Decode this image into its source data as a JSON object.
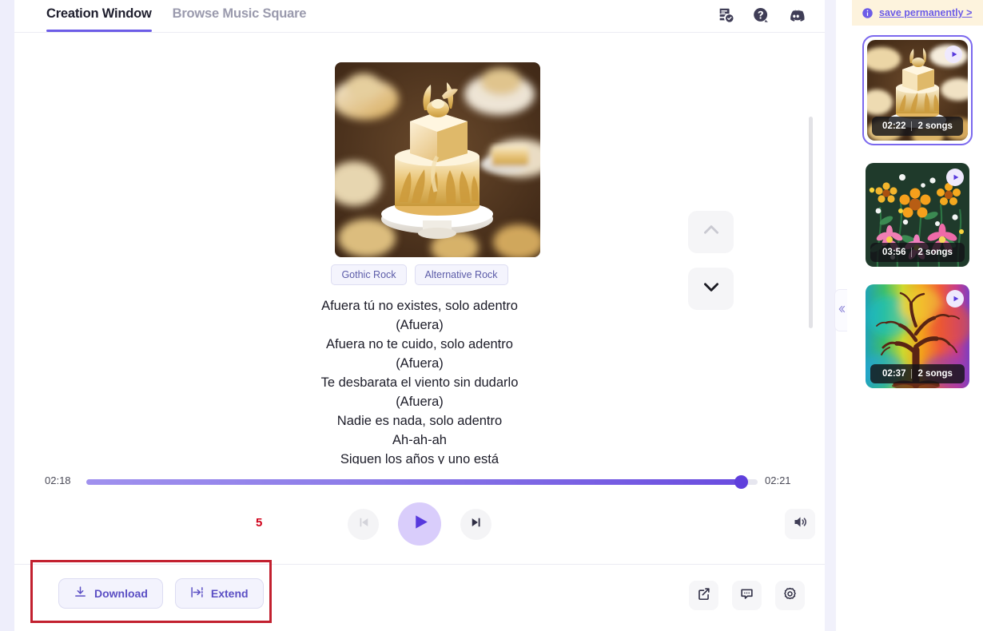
{
  "header": {
    "tabs": [
      {
        "label": "Creation Window",
        "active": true
      },
      {
        "label": "Browse Music Square",
        "active": false
      }
    ],
    "icons": [
      {
        "name": "document-check-icon",
        "title": "My Creations"
      },
      {
        "name": "help-circle-icon",
        "title": "Help"
      },
      {
        "name": "discord-icon",
        "title": "Discord"
      }
    ]
  },
  "player": {
    "album_art_alt": "Golden frosted cakes and desserts",
    "tags": [
      "Gothic Rock",
      "Alternative Rock"
    ],
    "lyrics": [
      "Afuera tú no existes, solo adentro",
      "(Afuera)",
      "Afuera no te cuido, solo adentro",
      "(Afuera)",
      "Te desbarata el viento sin dudarlo",
      "(Afuera)",
      "Nadie es nada, solo adentro",
      "Ah-ah-ah",
      "Siguen los años y uno está"
    ],
    "nav": {
      "up_label": "Previous track",
      "down_label": "Next track"
    },
    "current_time": "02:18",
    "total_time": "02:21",
    "progress_percent": 97.5,
    "annotation_marker": "5",
    "controls": {
      "prev_label": "Previous",
      "play_label": "Play",
      "next_label": "Next",
      "volume_label": "Volume"
    }
  },
  "bottom": {
    "actions": [
      {
        "label": "Download",
        "icon": "download-icon"
      },
      {
        "label": "Extend",
        "icon": "extend-icon"
      }
    ],
    "right_icons": [
      {
        "name": "share-external-icon",
        "title": "Share"
      },
      {
        "name": "comment-icon",
        "title": "Comment"
      },
      {
        "name": "settings-gear-icon",
        "title": "Settings"
      }
    ]
  },
  "collapse_handle": {
    "label": "Collapse panel",
    "icon": "chevron-double-left-icon"
  },
  "sidebar": {
    "banner": {
      "icon": "info-icon",
      "link_text": "save permanently >"
    },
    "items": [
      {
        "duration": "02:22",
        "songs": "2 songs",
        "selected": true,
        "art": "golden-cakes"
      },
      {
        "duration": "03:56",
        "songs": "2 songs",
        "selected": false,
        "art": "flower-field"
      },
      {
        "duration": "02:37",
        "songs": "2 songs",
        "selected": false,
        "art": "rainbow-tree"
      }
    ]
  },
  "colors": {
    "accent": "#6c5ce7",
    "accent_deep": "#5739dd",
    "tag_text": "#5b5ba8",
    "banner_bg": "#fdf3dd",
    "highlight_box": "#c2202f",
    "marker": "#d0021b"
  }
}
